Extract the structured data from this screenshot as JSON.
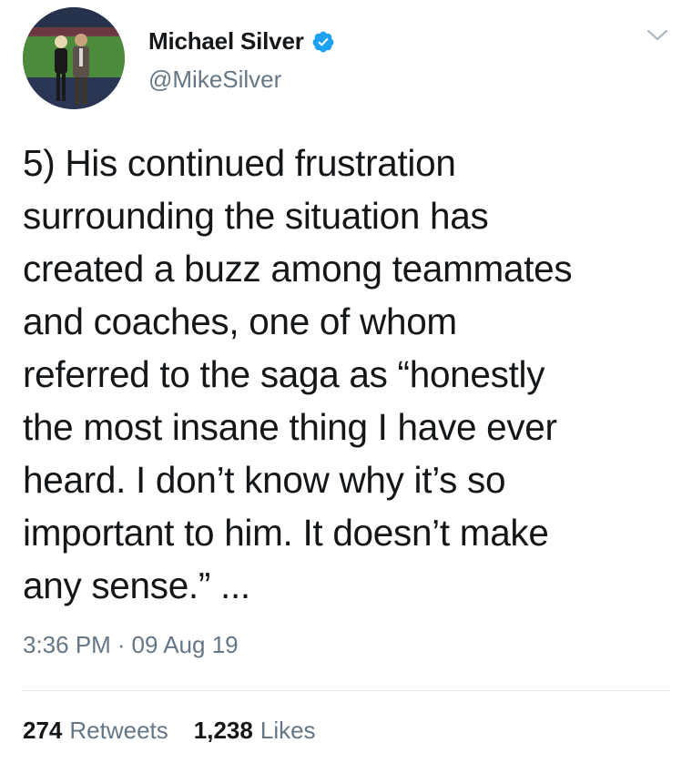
{
  "tweet": {
    "author": {
      "display_name": "Michael Silver",
      "handle": "@MikeSilver",
      "verified": true,
      "avatar_icon": "profile-photo"
    },
    "text": "5) His continued frustration\nsurrounding the situation has\ncreated a buzz among teammates\nand coaches, one of whom\nreferred to the saga as “honestly\nthe most insane thing I have ever\nheard. I don’t know why it’s so\nimportant to him. It doesn’t make\nany sense.” ...",
    "time": "3:36 PM",
    "separator": "·",
    "date": "09 Aug 19",
    "stats": {
      "retweets_count": "274",
      "retweets_label": "Retweets",
      "likes_count": "1,238",
      "likes_label": "Likes"
    }
  },
  "colors": {
    "text_primary": "#14171a",
    "text_secondary": "#657786",
    "verified_blue": "#1da1f2",
    "divider": "#e1e8ed"
  },
  "icons": {
    "verified": "verified-badge-icon",
    "menu": "chevron-down-icon"
  }
}
